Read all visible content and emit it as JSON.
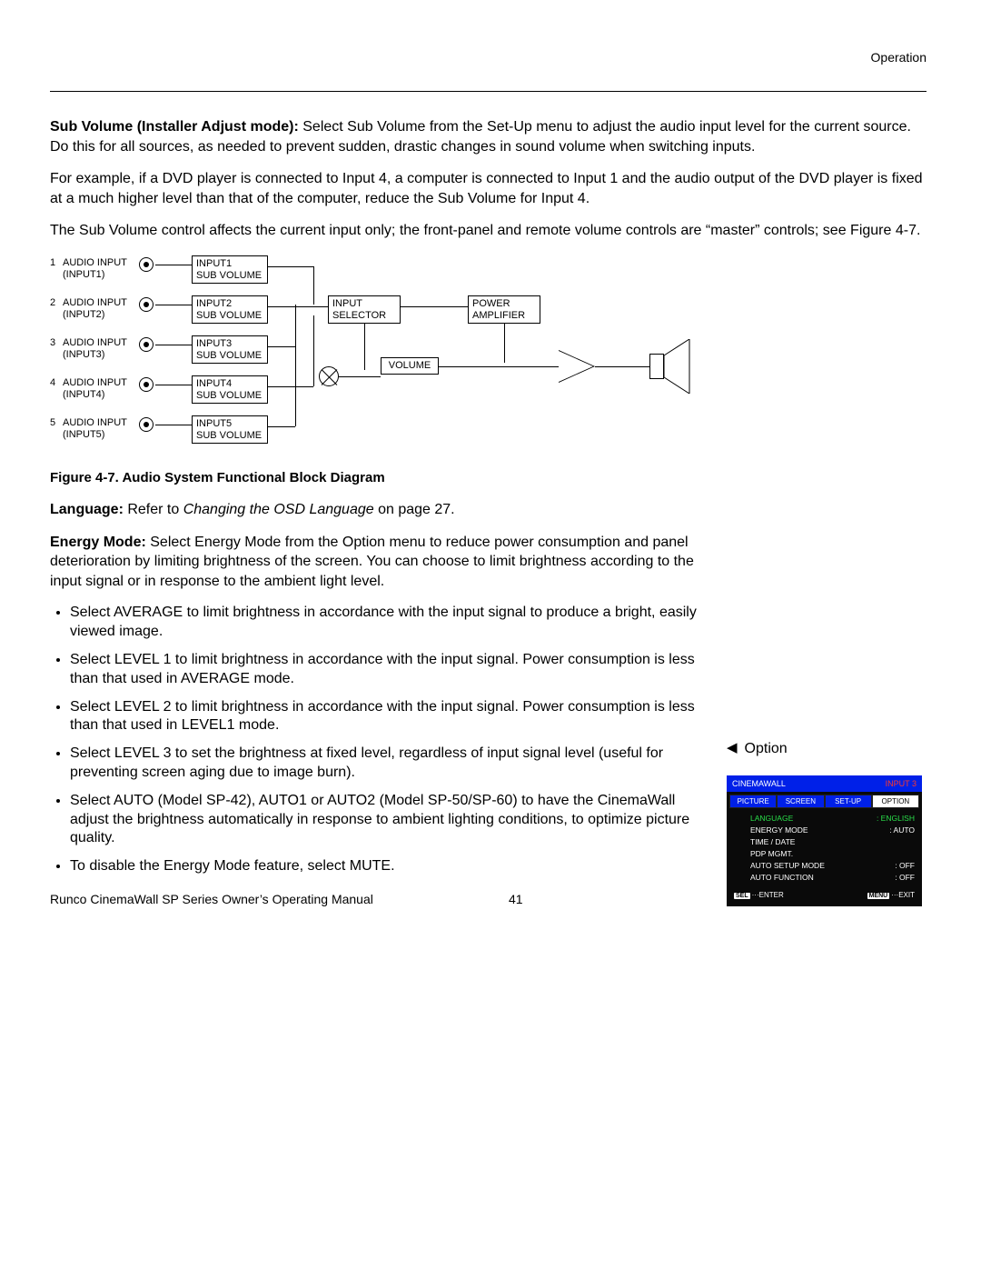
{
  "header": {
    "section": "Operation"
  },
  "para1": {
    "lead": "Sub Volume (Installer Adjust mode):",
    "rest": " Select Sub Volume from the Set-Up menu to adjust the audio input level for the current source. Do this for all sources, as needed to prevent sudden, drastic changes in sound volume when switching inputs."
  },
  "para2": "For example, if a DVD player is connected to Input 4, a computer is connected to Input 1 and the audio output of the DVD player is fixed at a much higher level than that of the computer, reduce the Sub Volume for Input 4.",
  "para3": "The Sub Volume control affects the current input only; the front-panel and remote volume controls are “master” controls; see Figure 4-7.",
  "diagram": {
    "inputs": [
      {
        "n": "1",
        "label": "AUDIO INPUT",
        "sub": "(INPUT1)",
        "box1": "INPUT1",
        "box2": "SUB VOLUME"
      },
      {
        "n": "2",
        "label": "AUDIO INPUT",
        "sub": "(INPUT2)",
        "box1": "INPUT2",
        "box2": "SUB VOLUME"
      },
      {
        "n": "3",
        "label": "AUDIO INPUT",
        "sub": "(INPUT3)",
        "box1": "INPUT3",
        "box2": "SUB VOLUME"
      },
      {
        "n": "4",
        "label": "AUDIO INPUT",
        "sub": "(INPUT4)",
        "box1": "INPUT4",
        "box2": "SUB VOLUME"
      },
      {
        "n": "5",
        "label": "AUDIO INPUT",
        "sub": "(INPUT5)",
        "box1": "INPUT5",
        "box2": "SUB VOLUME"
      }
    ],
    "selector1": "INPUT",
    "selector2": "SELECTOR",
    "volume": "VOLUME",
    "amp1": "POWER",
    "amp2": "AMPLIFIER"
  },
  "figcap": "Figure 4-7. Audio System Functional Block Diagram",
  "lang_para": {
    "lead": "Language:",
    "mid": " Refer to ",
    "italic": "Changing the OSD Language",
    "rest": " on page 27."
  },
  "energy_para": {
    "lead": "Energy Mode:",
    "rest": " Select Energy Mode from the Option menu to reduce power consumption and panel deterioration by limiting brightness of the screen. You can choose to limit brightness according to the input signal or in response to the ambient light level."
  },
  "bullets": [
    "Select AVERAGE to limit brightness in accordance with the input signal to produce a bright, easily viewed image.",
    "Select LEVEL 1 to limit brightness in accordance with the input signal. Power consumption is less than that used in AVERAGE mode.",
    "Select LEVEL 2 to limit brightness in accordance with the input signal. Power consumption is less than that used in LEVEL1 mode.",
    "Select LEVEL 3 to set the brightness at fixed level, regardless of input signal level (useful for preventing screen aging due to image burn).",
    "Select AUTO (Model SP-42), AUTO1 or AUTO2 (Model SP-50/SP-60) to have the CinemaWall adjust the brightness automatically in response to ambient lighting conditions, to optimize picture quality.",
    "To disable the Energy Mode feature, select MUTE."
  ],
  "right": {
    "option_title": "Option"
  },
  "osd": {
    "brand": "CINEMAWALL",
    "input": "INPUT 3",
    "tabs": [
      "PICTURE",
      "SCREEN",
      "SET-UP",
      "OPTION"
    ],
    "active_tab": 3,
    "rows": [
      {
        "k": "LANGUAGE",
        "v": ": ENGLISH",
        "hl": true
      },
      {
        "k": "ENERGY MODE",
        "v": ": AUTO",
        "hl": false
      },
      {
        "k": "TIME / DATE",
        "v": "",
        "hl": false
      },
      {
        "k": "PDP MGMT.",
        "v": "",
        "hl": false
      },
      {
        "k": "AUTO SETUP MODE",
        "v": ": OFF",
        "hl": false
      },
      {
        "k": "AUTO FUNCTION",
        "v": ": OFF",
        "hl": false
      }
    ],
    "foot_left_badge": "SEL",
    "foot_left": "···ENTER",
    "foot_right_badge": "MENU",
    "foot_right": "···EXIT"
  },
  "footer": {
    "text": "Runco CinemaWall SP Series Owner’s Operating Manual",
    "page": "41"
  }
}
